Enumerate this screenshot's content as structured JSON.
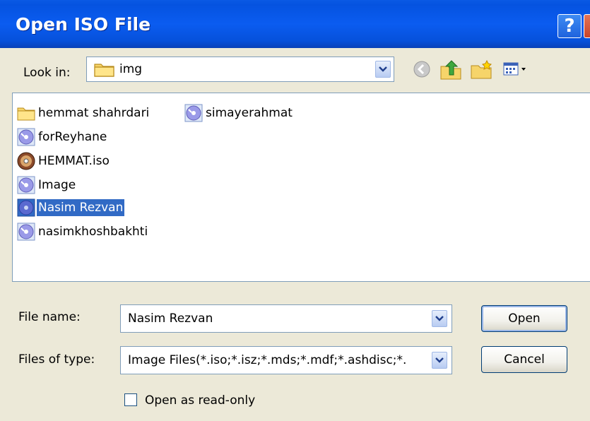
{
  "window": {
    "title": "Open ISO File",
    "help_label": "?",
    "close_label": "✕"
  },
  "lookin": {
    "label": "Look in:",
    "value": "img"
  },
  "toolbar": {
    "icons": [
      "back-icon",
      "up-folder-icon",
      "new-folder-icon",
      "views-menu-icon"
    ]
  },
  "files": [
    {
      "name": "hemmat shahrdari",
      "icon": "folder-icon"
    },
    {
      "name": "simayerahmat",
      "icon": "disc-image-icon"
    },
    {
      "name": "forReyhane",
      "icon": "disc-image-icon"
    },
    {
      "name": "HEMMAT.iso",
      "icon": "cd-icon"
    },
    {
      "name": "Image",
      "icon": "disc-image-icon"
    },
    {
      "name": "Nasim Rezvan",
      "icon": "disc-image-icon",
      "selected": true
    },
    {
      "name": "nasimkhoshbakhti",
      "icon": "disc-image-icon"
    }
  ],
  "filename": {
    "label": "File name:",
    "value": "Nasim Rezvan"
  },
  "filetype": {
    "label": "Files of type:",
    "value": "Image Files(*.iso;*.isz;*.mds;*.mdf;*.ashdisc;*."
  },
  "buttons": {
    "open": "Open",
    "cancel": "Cancel"
  },
  "readonly": {
    "label": "Open as read-only",
    "checked": false
  },
  "colors": {
    "titlebar": "#0b5cf0",
    "dialog_bg": "#ece9d8",
    "selection": "#316ac5"
  }
}
